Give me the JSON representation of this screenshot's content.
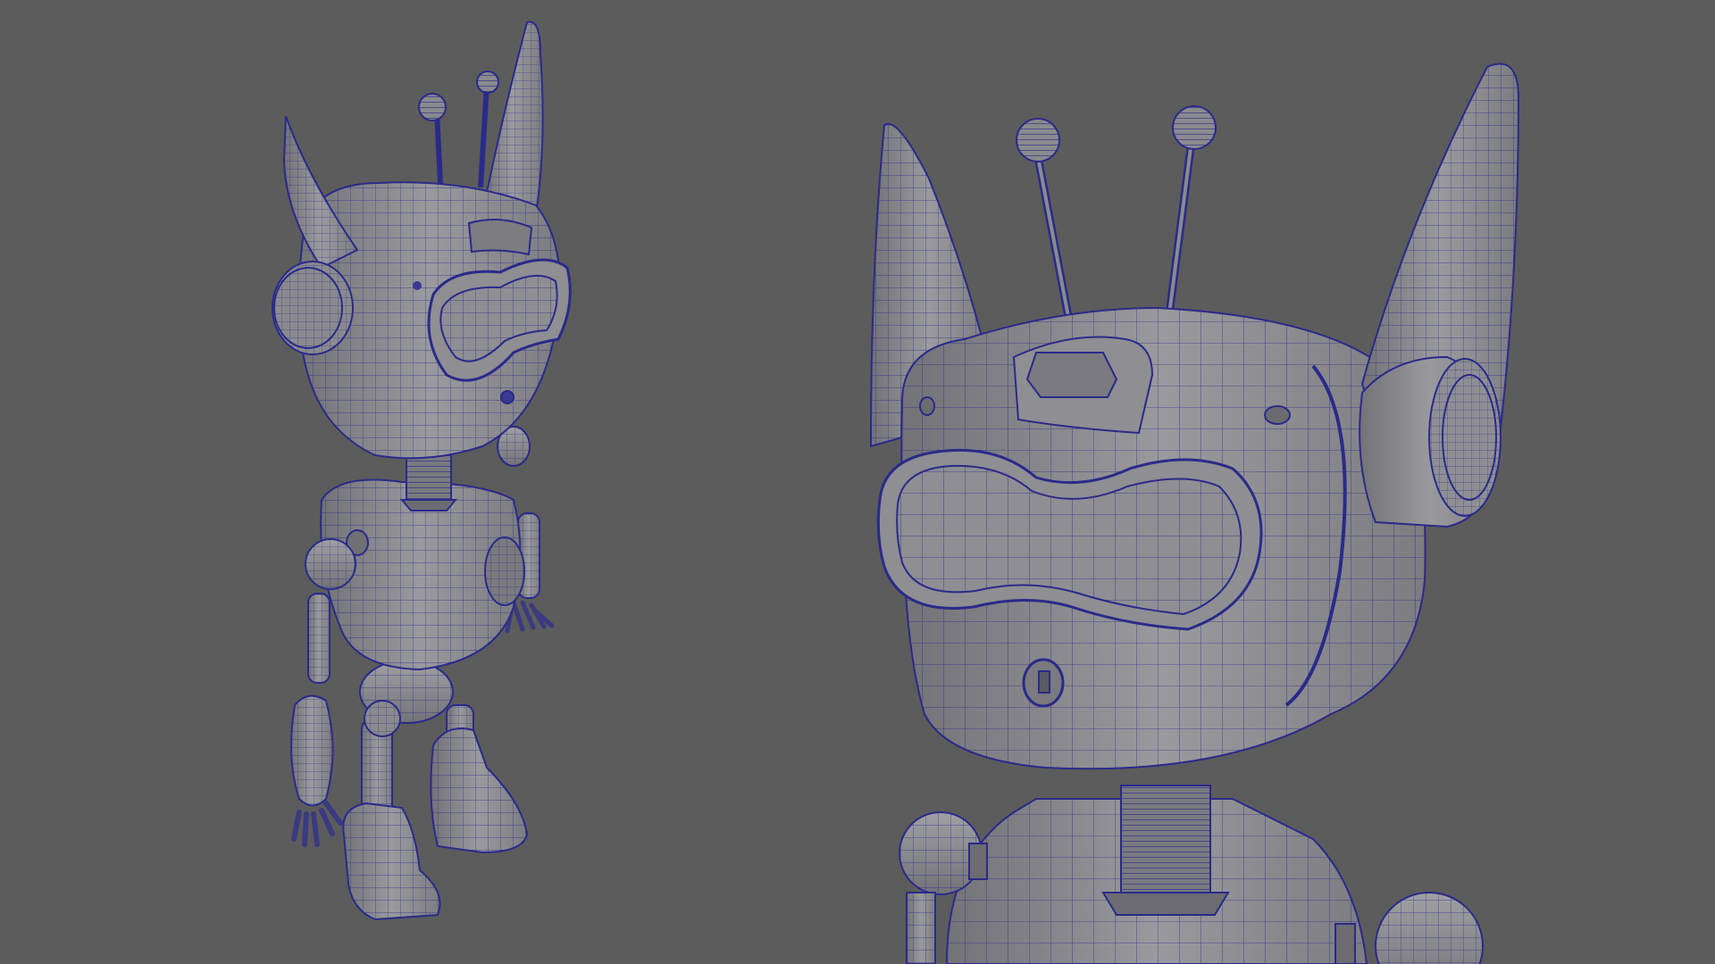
{
  "scene": {
    "background_color": "#5c5c5c",
    "model_fill": "#8a8a8e",
    "model_shade": "#6f6f74",
    "model_light": "#a3a3a7",
    "wire_color": "#2a2a8a",
    "views": [
      "full-body-three-quarter-view",
      "head-close-up-view"
    ]
  }
}
